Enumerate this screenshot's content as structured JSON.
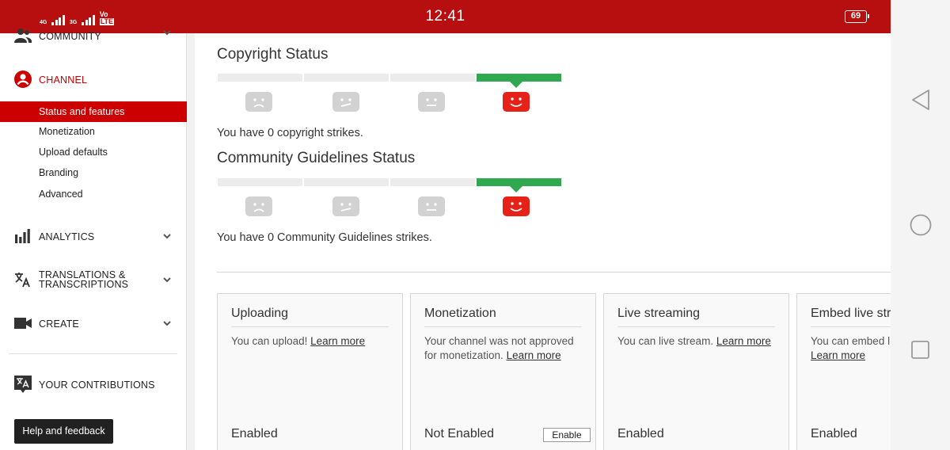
{
  "status_bar": {
    "network_4g": "4G",
    "network_3g": "3G",
    "volte_top": "Vo",
    "volte_bottom": "LTE",
    "time": "12:41",
    "battery": "69"
  },
  "sidebar": {
    "community_label": "COMMUNITY",
    "channel_label": "CHANNEL",
    "channel_items": [
      {
        "label": "Status and features",
        "active": true
      },
      {
        "label": "Monetization",
        "active": false
      },
      {
        "label": "Upload defaults",
        "active": false
      },
      {
        "label": "Branding",
        "active": false
      },
      {
        "label": "Advanced",
        "active": false
      }
    ],
    "analytics_label": "ANALYTICS",
    "translations_label_line1": "TRANSLATIONS &",
    "translations_label_line2": "TRANSCRIPTIONS",
    "create_label": "CREATE",
    "contributions_label": "YOUR CONTRIBUTIONS",
    "help_button": "Help and feedback"
  },
  "main": {
    "copyright": {
      "title": "Copyright Status",
      "strike_count": 0,
      "text": "You have 0 copyright strikes."
    },
    "community": {
      "title": "Community Guidelines Status",
      "strike_count": 0,
      "text": "You have 0 Community Guidelines strikes."
    },
    "cards": [
      {
        "title": "Uploading",
        "desc": "You can upload!",
        "link": "Learn more",
        "status": "Enabled"
      },
      {
        "title": "Monetization",
        "desc": "Your channel was not approved for monetization.",
        "link": "Learn more",
        "status": "Not Enabled",
        "button": "Enable"
      },
      {
        "title": "Live streaming",
        "desc": "You can live stream.",
        "link": "Learn more",
        "status": "Enabled"
      },
      {
        "title": "Embed live stre",
        "desc": "You can embed li",
        "link": "Learn more",
        "status": "Enabled"
      }
    ]
  },
  "colors": {
    "status_bar": "#b70f0f",
    "accent_red": "#cc0000",
    "meter_green": "#2fa84f",
    "face_grey": "#d2d2d2",
    "face_red": "#e62117"
  },
  "icons": {
    "community": "people-icon",
    "channel": "account-circle-icon",
    "analytics": "bar-chart-icon",
    "translations": "translate-icon",
    "create": "video-camera-icon",
    "contributions": "translate-box-icon",
    "nav_back": "back-triangle-icon",
    "nav_home": "home-circle-icon",
    "nav_recents": "recents-square-icon"
  }
}
